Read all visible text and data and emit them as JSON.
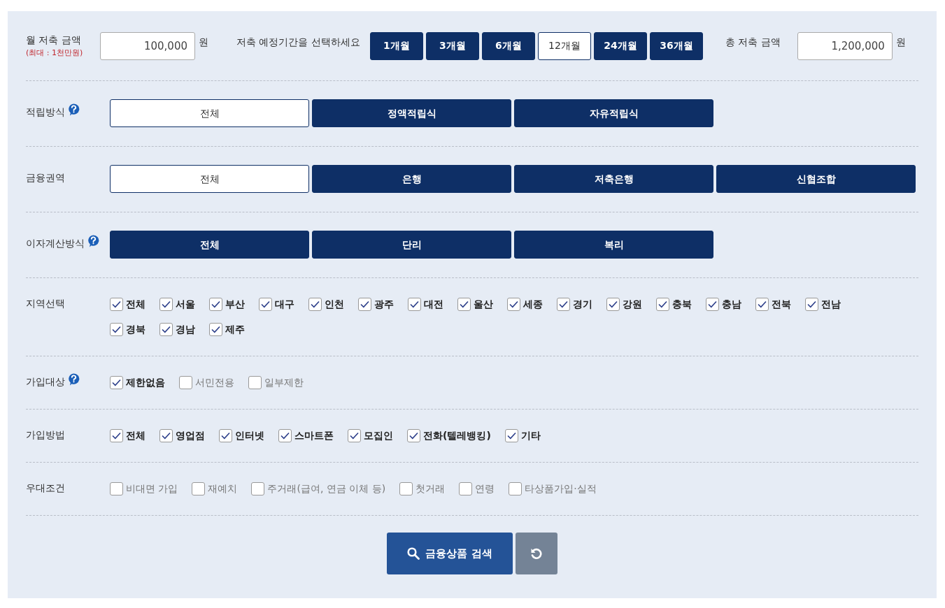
{
  "monthly": {
    "label": "월 저축 금액",
    "note": "(최대 : 1천만원)",
    "value": "100,000",
    "unit": "원"
  },
  "period": {
    "label": "저축 예정기간을 선택하세요",
    "options": [
      {
        "label": "1개월",
        "selected": false
      },
      {
        "label": "3개월",
        "selected": false
      },
      {
        "label": "6개월",
        "selected": false
      },
      {
        "label": "12개월",
        "selected": true
      },
      {
        "label": "24개월",
        "selected": false
      },
      {
        "label": "36개월",
        "selected": false
      }
    ]
  },
  "total": {
    "label": "총 저축 금액",
    "value": "1,200,000",
    "unit": "원"
  },
  "sections": [
    {
      "kind": "buttons",
      "label": "적립방식",
      "help": true,
      "options": [
        {
          "label": "전체",
          "selected": true
        },
        {
          "label": "정액적립식",
          "selected": false
        },
        {
          "label": "자유적립식",
          "selected": false
        }
      ]
    },
    {
      "kind": "buttons",
      "label": "금융권역",
      "help": false,
      "options": [
        {
          "label": "전체",
          "selected": true
        },
        {
          "label": "은행",
          "selected": false
        },
        {
          "label": "저축은행",
          "selected": false
        },
        {
          "label": "신협조합",
          "selected": false
        }
      ]
    },
    {
      "kind": "buttons",
      "label": "이자계산방식",
      "help": true,
      "options": [
        {
          "label": "전체",
          "selected": false
        },
        {
          "label": "단리",
          "selected": false
        },
        {
          "label": "복리",
          "selected": false
        }
      ]
    },
    {
      "kind": "checks",
      "label": "지역선택",
      "help": false,
      "options": [
        {
          "label": "전체",
          "checked": true
        },
        {
          "label": "서울",
          "checked": true
        },
        {
          "label": "부산",
          "checked": true
        },
        {
          "label": "대구",
          "checked": true
        },
        {
          "label": "인천",
          "checked": true
        },
        {
          "label": "광주",
          "checked": true
        },
        {
          "label": "대전",
          "checked": true
        },
        {
          "label": "울산",
          "checked": true
        },
        {
          "label": "세종",
          "checked": true
        },
        {
          "label": "경기",
          "checked": true
        },
        {
          "label": "강원",
          "checked": true
        },
        {
          "label": "충북",
          "checked": true
        },
        {
          "label": "충남",
          "checked": true
        },
        {
          "label": "전북",
          "checked": true
        },
        {
          "label": "전남",
          "checked": true
        },
        {
          "label": "경북",
          "checked": true
        },
        {
          "label": "경남",
          "checked": true
        },
        {
          "label": "제주",
          "checked": true
        }
      ]
    },
    {
      "kind": "checks",
      "label": "가입대상",
      "help": true,
      "options": [
        {
          "label": "제한없음",
          "checked": true
        },
        {
          "label": "서민전용",
          "checked": false
        },
        {
          "label": "일부제한",
          "checked": false
        }
      ]
    },
    {
      "kind": "checks",
      "label": "가입방법",
      "help": false,
      "options": [
        {
          "label": "전체",
          "checked": true
        },
        {
          "label": "영업점",
          "checked": true
        },
        {
          "label": "인터넷",
          "checked": true
        },
        {
          "label": "스마트폰",
          "checked": true
        },
        {
          "label": "모집인",
          "checked": true
        },
        {
          "label": "전화(텔레뱅킹)",
          "checked": true
        },
        {
          "label": "기타",
          "checked": true
        }
      ]
    },
    {
      "kind": "checks",
      "label": "우대조건",
      "help": false,
      "options": [
        {
          "label": "비대면 가입",
          "checked": false
        },
        {
          "label": "재예치",
          "checked": false
        },
        {
          "label": "주거래(급여, 연금 이체 등)",
          "checked": false
        },
        {
          "label": "첫거래",
          "checked": false
        },
        {
          "label": "연령",
          "checked": false
        },
        {
          "label": "타상품가입·실적",
          "checked": false
        }
      ]
    }
  ],
  "search_button": "금융상품 검색"
}
